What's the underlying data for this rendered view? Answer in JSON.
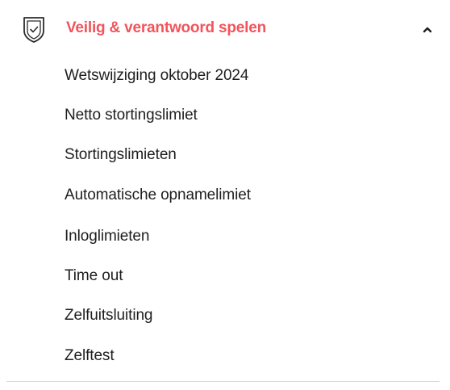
{
  "section": {
    "title": "Veilig & verantwoord spelen",
    "accent_color": "#f2545b",
    "icon": "shield-check-icon",
    "expanded_indicator": "chevron-up-icon",
    "items": [
      {
        "label": "Wetswijziging oktober 2024"
      },
      {
        "label": "Netto stortingslimiet"
      },
      {
        "label": "Stortingslimieten"
      },
      {
        "label": "Automatische opnamelimiet"
      },
      {
        "label": "Inloglimieten"
      },
      {
        "label": "Time out"
      },
      {
        "label": "Zelfuitsluiting"
      },
      {
        "label": "Zelftest"
      }
    ]
  }
}
